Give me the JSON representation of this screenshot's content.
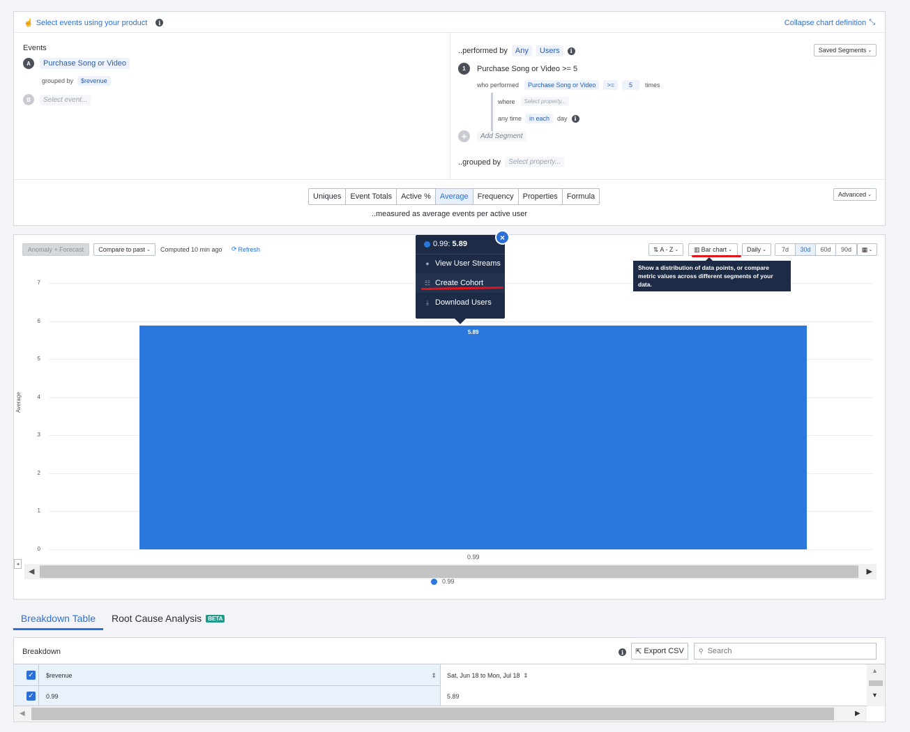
{
  "header": {
    "select_events_link": "Select events using your product",
    "collapse_link": "Collapse chart definition"
  },
  "events": {
    "title": "Events",
    "event_a_letter": "A",
    "event_a_name": "Purchase Song or Video",
    "grouped_by_label": "grouped by",
    "grouped_by_value": "$revenue",
    "event_b_letter": "B",
    "event_b_placeholder": "Select event..."
  },
  "performed": {
    "label": "..performed by",
    "any": "Any",
    "users": "Users",
    "saved_segments": "Saved Segments",
    "segment_number": "1",
    "segment_title": "Purchase Song or Video >= 5",
    "who_performed": "who performed",
    "who_event": "Purchase Song or Video",
    "operator": ">=",
    "count": "5",
    "times": "times",
    "where": "where",
    "where_placeholder": "Select property...",
    "any_time": "any time",
    "in_each": "in each",
    "day": "day",
    "add_segment": "Add Segment",
    "grouped_by_label": "..grouped by",
    "grouped_by_placeholder": "Select property..."
  },
  "measure": {
    "tabs": [
      "Uniques",
      "Event Totals",
      "Active %",
      "Average",
      "Frequency",
      "Properties",
      "Formula"
    ],
    "active_tab": "Average",
    "caption": "..measured as average events per active user",
    "advanced": "Advanced"
  },
  "toolbar": {
    "anomaly": "Anomaly + Forecast",
    "compare": "Compare to past",
    "computed": "Computed 10 min ago",
    "refresh": "Refresh",
    "sort": "A - Z",
    "chart_type": "Bar chart",
    "interval": "Daily",
    "ranges": [
      "7d",
      "30d",
      "60d",
      "90d"
    ],
    "active_range": "30d",
    "chart_type_tooltip": "Show a distribution of data points, or compare metric values across different segments of your data."
  },
  "popup": {
    "title_key": "0.99",
    "title_val": "5.89",
    "items": [
      "View User Streams",
      "Create Cohort",
      "Download Users"
    ]
  },
  "chart_data": {
    "type": "bar",
    "categories": [
      "0.99"
    ],
    "series": [
      {
        "name": "0.99",
        "values": [
          5.89
        ],
        "color": "#2a77dd"
      }
    ],
    "ylabel": "Average",
    "ylim": [
      0,
      7
    ],
    "yticks": [
      0,
      1,
      2,
      3,
      4,
      5,
      6,
      7
    ],
    "data_labels": [
      "5.89"
    ],
    "legend_placement": "bottom",
    "grid": true
  },
  "bottom_tabs": {
    "breakdown": "Breakdown Table",
    "rca": "Root Cause Analysis",
    "beta": "BETA"
  },
  "breakdown": {
    "title": "Breakdown",
    "export": "Export CSV",
    "search_placeholder": "Search",
    "columns": [
      "$revenue",
      "Sat, Jun 18 to Mon, Jul 18"
    ],
    "rows": [
      [
        "0.99",
        "5.89"
      ]
    ]
  },
  "colors": {
    "accent": "#2c6fd6",
    "bar": "#2a77dd",
    "tooltip_bg": "#1d2b46",
    "highlight_red": "#e3141b"
  }
}
